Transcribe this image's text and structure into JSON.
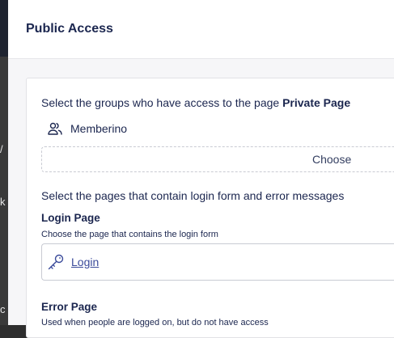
{
  "backdrop": {
    "fragments": [
      "/",
      "k",
      "c"
    ]
  },
  "dialog": {
    "title": "Public Access"
  },
  "groups": {
    "intro_prefix": "Select the groups who have access to the page ",
    "page_name": "Private Page",
    "items": [
      {
        "label": "Memberino",
        "icon": "users-icon"
      }
    ],
    "choose_label": "Choose"
  },
  "pages": {
    "intro": "Select the pages that contain login form and error messages",
    "login": {
      "title": "Login Page",
      "help": "Choose the page that contains the login form",
      "link_label": "Login",
      "icon": "key-icon"
    },
    "error": {
      "title": "Error Page",
      "help": "Used when people are logged on, but do not have access"
    }
  },
  "colors": {
    "text": "#1b264f",
    "link": "#3a4a9a",
    "border": "#c9cbd3"
  }
}
